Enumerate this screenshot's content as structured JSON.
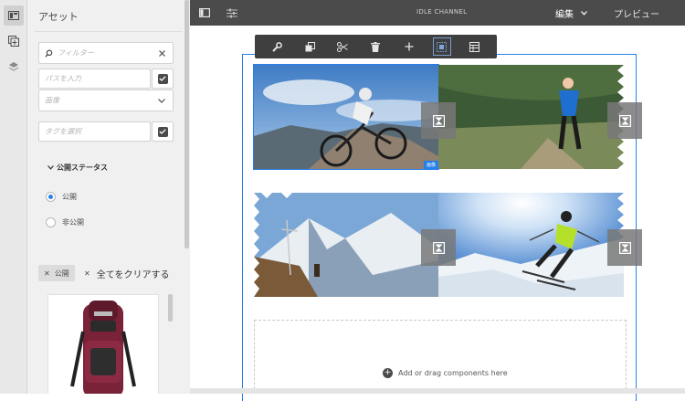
{
  "sidebar": {
    "title": "アセット",
    "filter_placeholder": "フィルター",
    "path_placeholder": "パスを入力",
    "type_placeholder": "画像",
    "tag_placeholder": "タグを選択",
    "status_section": "公開ステータス",
    "status_options": [
      {
        "label": "公開",
        "selected": true
      },
      {
        "label": "非公開",
        "selected": false
      }
    ],
    "active_filter_chip": "公開",
    "clear_all": "全てをクリアする"
  },
  "topbar": {
    "page_title": "IDLE CHANNEL",
    "mode": "編集",
    "preview": "プレビュー"
  },
  "canvas": {
    "selected_badge": "画像",
    "drop_zone": "Add or drag components here"
  },
  "colors": {
    "accent": "#2680eb",
    "topbar": "#4b4b4b",
    "panel": "#f0f0f0",
    "toolbar": "#3f3f3f"
  },
  "icons": {
    "rail": [
      "panels-icon",
      "assets-icon",
      "layers-icon"
    ],
    "toolbar": [
      "wrench-icon",
      "copy-icon",
      "cut-icon",
      "trash-icon",
      "plus-icon",
      "group-icon",
      "layout-icon"
    ]
  }
}
